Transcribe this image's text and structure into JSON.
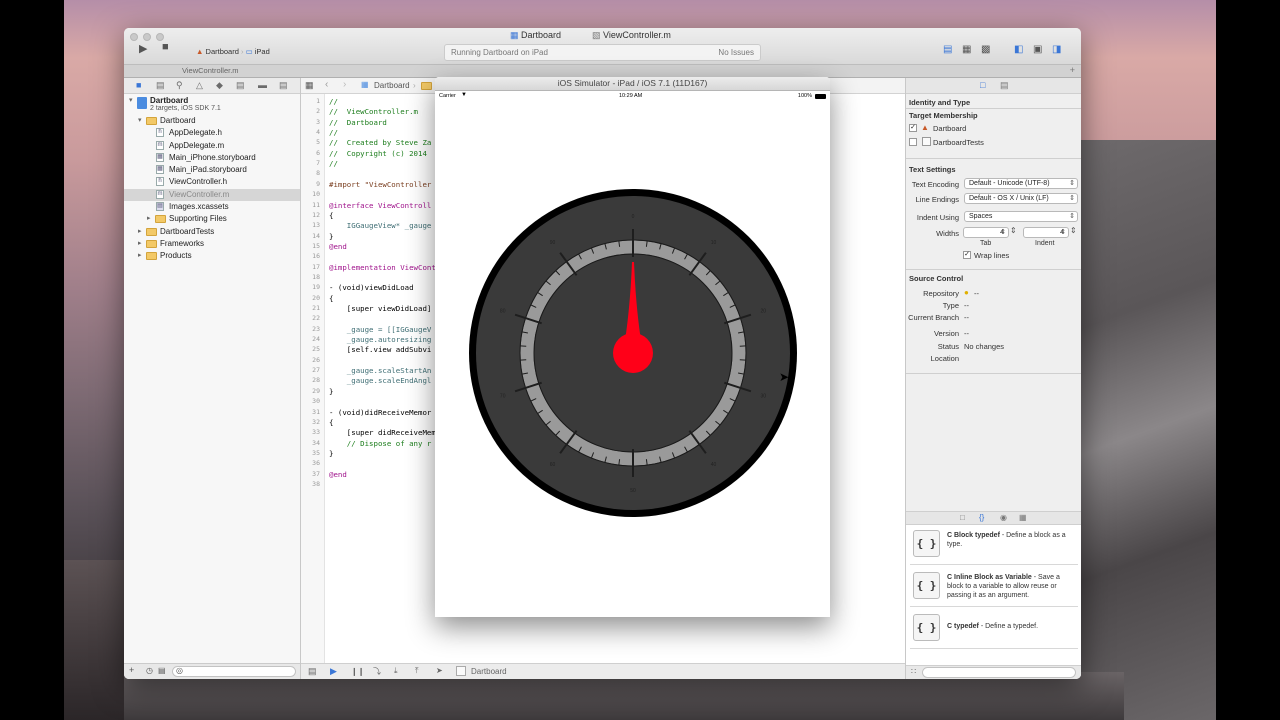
{
  "window": {
    "tab_left": "Dartboard",
    "tab_right": "ViewController.m",
    "scheme": "Dartboard",
    "device": "iPad",
    "status": "Running Dartboard on iPad",
    "issues": "No Issues",
    "tab_file": "ViewController.m"
  },
  "navigator": {
    "project": "Dartboard",
    "project_sub": "2 targets, iOS SDK 7.1",
    "items": [
      {
        "label": "Dartboard",
        "kind": "group"
      },
      {
        "label": "AppDelegate.h",
        "kind": "h"
      },
      {
        "label": "AppDelegate.m",
        "kind": "m"
      },
      {
        "label": "Main_iPhone.storyboard",
        "kind": "sb"
      },
      {
        "label": "Main_iPad.storyboard",
        "kind": "sb"
      },
      {
        "label": "ViewController.h",
        "kind": "h"
      },
      {
        "label": "ViewController.m",
        "kind": "m"
      },
      {
        "label": "Images.xcassets",
        "kind": "asset"
      },
      {
        "label": "Supporting Files",
        "kind": "group"
      },
      {
        "label": "DartboardTests",
        "kind": "group"
      },
      {
        "label": "Frameworks",
        "kind": "group"
      },
      {
        "label": "Products",
        "kind": "group"
      }
    ]
  },
  "editor": {
    "jump_crumb": "Dartboard",
    "lines": [
      {
        "n": "1",
        "t": "//"
      },
      {
        "n": "2",
        "t": "//  ViewController.m"
      },
      {
        "n": "3",
        "t": "//  Dartboard"
      },
      {
        "n": "4",
        "t": "//"
      },
      {
        "n": "5",
        "t": "//  Created by Steve Za"
      },
      {
        "n": "6",
        "t": "//  Copyright (c) 2014"
      },
      {
        "n": "7",
        "t": "//"
      },
      {
        "n": "8",
        "t": ""
      },
      {
        "n": "9",
        "t": "#import \"ViewController"
      },
      {
        "n": "10",
        "t": ""
      },
      {
        "n": "11",
        "t": "@interface ViewControll"
      },
      {
        "n": "12",
        "t": "{"
      },
      {
        "n": "13",
        "t": "    IGGaugeView* _gauge"
      },
      {
        "n": "14",
        "t": "}"
      },
      {
        "n": "15",
        "t": "@end"
      },
      {
        "n": "16",
        "t": ""
      },
      {
        "n": "17",
        "t": "@implementation ViewCont"
      },
      {
        "n": "18",
        "t": ""
      },
      {
        "n": "19",
        "t": "- (void)viewDidLoad"
      },
      {
        "n": "20",
        "t": "{"
      },
      {
        "n": "21",
        "t": "    [super viewDidLoad]"
      },
      {
        "n": "22",
        "t": ""
      },
      {
        "n": "23",
        "t": "    _gauge = [[IGGaugeV"
      },
      {
        "n": "24",
        "t": "    _gauge.autoresizing"
      },
      {
        "n": "25",
        "t": "    [self.view addSubvi"
      },
      {
        "n": "26",
        "t": ""
      },
      {
        "n": "27",
        "t": "    _gauge.scaleStartAn"
      },
      {
        "n": "28",
        "t": "    _gauge.scaleEndAngl"
      },
      {
        "n": "29",
        "t": "}"
      },
      {
        "n": "30",
        "t": ""
      },
      {
        "n": "31",
        "t": "- (void)didReceiveMemor"
      },
      {
        "n": "32",
        "t": "{"
      },
      {
        "n": "33",
        "t": "    [super didReceiveMem"
      },
      {
        "n": "34",
        "t": "    // Dispose of any r"
      },
      {
        "n": "35",
        "t": "}"
      },
      {
        "n": "36",
        "t": ""
      },
      {
        "n": "37",
        "t": "@end"
      },
      {
        "n": "38",
        "t": ""
      }
    ],
    "debug_target": "Dartboard"
  },
  "simulator": {
    "title": "iOS Simulator - iPad / iOS 7.1 (11D167)",
    "carrier": "Carrier",
    "time": "10:29 AM",
    "battery": "100%",
    "gauge": {
      "labels": [
        "0",
        "10",
        "20",
        "30",
        "40",
        "50",
        "60",
        "70",
        "80",
        "90"
      ],
      "needle_value": 0,
      "colors": {
        "rim": "#000000",
        "face": "#3a3a3a",
        "scale": "#9a9a9a",
        "needle": "#ff0018"
      }
    }
  },
  "inspector": {
    "identity_type": "Identity and Type",
    "target_membership": "Target Membership",
    "targets": [
      {
        "label": "Dartboard",
        "checked": true
      },
      {
        "label": "DartboardTests",
        "checked": false
      }
    ],
    "text_settings": "Text Settings",
    "encoding_label": "Text Encoding",
    "encoding_value": "Default - Unicode (UTF-8)",
    "endings_label": "Line Endings",
    "endings_value": "Default - OS X / Unix (LF)",
    "indent_label": "Indent Using",
    "indent_value": "Spaces",
    "widths_label": "Widths",
    "tab_width": "4",
    "indent_width": "4",
    "tab_caption": "Tab",
    "indent_caption": "Indent",
    "wrap_lines": "Wrap lines",
    "source_control": "Source Control",
    "repository_label": "Repository",
    "repository_value": "--",
    "type_label": "Type",
    "type_value": "--",
    "branch_label": "Current Branch",
    "branch_value": "--",
    "version_label": "Version",
    "version_value": "--",
    "status_label": "Status",
    "status_value": "No changes",
    "location_label": "Location",
    "snippets": [
      {
        "title": "C Block typedef",
        "desc": " - Define a block as a type."
      },
      {
        "title": "C Inline Block as Variable",
        "desc": " - Save a block to a variable to allow reuse or passing it as an argument."
      },
      {
        "title": "C typedef",
        "desc": " - Define a typedef."
      }
    ],
    "snippet_icon": "{ }"
  }
}
